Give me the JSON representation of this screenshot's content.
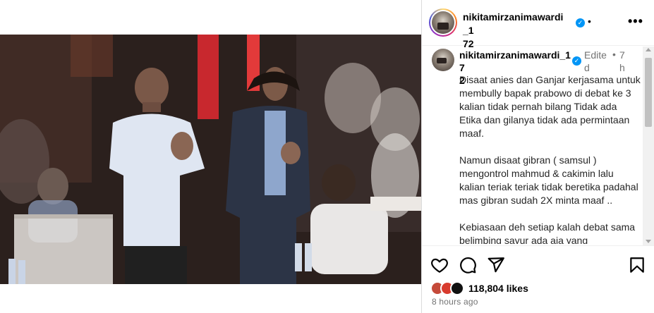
{
  "post": {
    "username_line1": "nikitamirzanimawardi_1",
    "username_line2": "72",
    "dot": "•",
    "more": "•••"
  },
  "caption": {
    "username_line1": "nikitamirzanimawardi_17",
    "username_line2": "2",
    "edited": "Edite d",
    "dot": "•",
    "time": "7 h",
    "paragraphs": [
      "Disaat anies dan Ganjar kerjasama untuk membully bapak prabowo di debat ke 3 kalian tidak pernah bilang Tidak ada Etika dan gilanya tidak ada permintaan maaf.",
      "Namun disaat gibran ( samsul ) mengontrol mahmud & cakimin lalu kalian teriak teriak tidak beretika padahal mas gibran sudah 2X minta maaf ..",
      "Kebiasaan deh setiap kalah debat sama belimbing sayur ada aja yang"
    ]
  },
  "actions": {
    "like_icon": "heart-icon",
    "comment_icon": "comment-icon",
    "share_icon": "share-icon",
    "save_icon": "bookmark-icon"
  },
  "likes": {
    "count": "118,804 likes"
  },
  "timestamp": "8 hours ago",
  "colors": {
    "verified": "#0095f6",
    "muted": "#737373",
    "border": "#dbdbdb"
  }
}
